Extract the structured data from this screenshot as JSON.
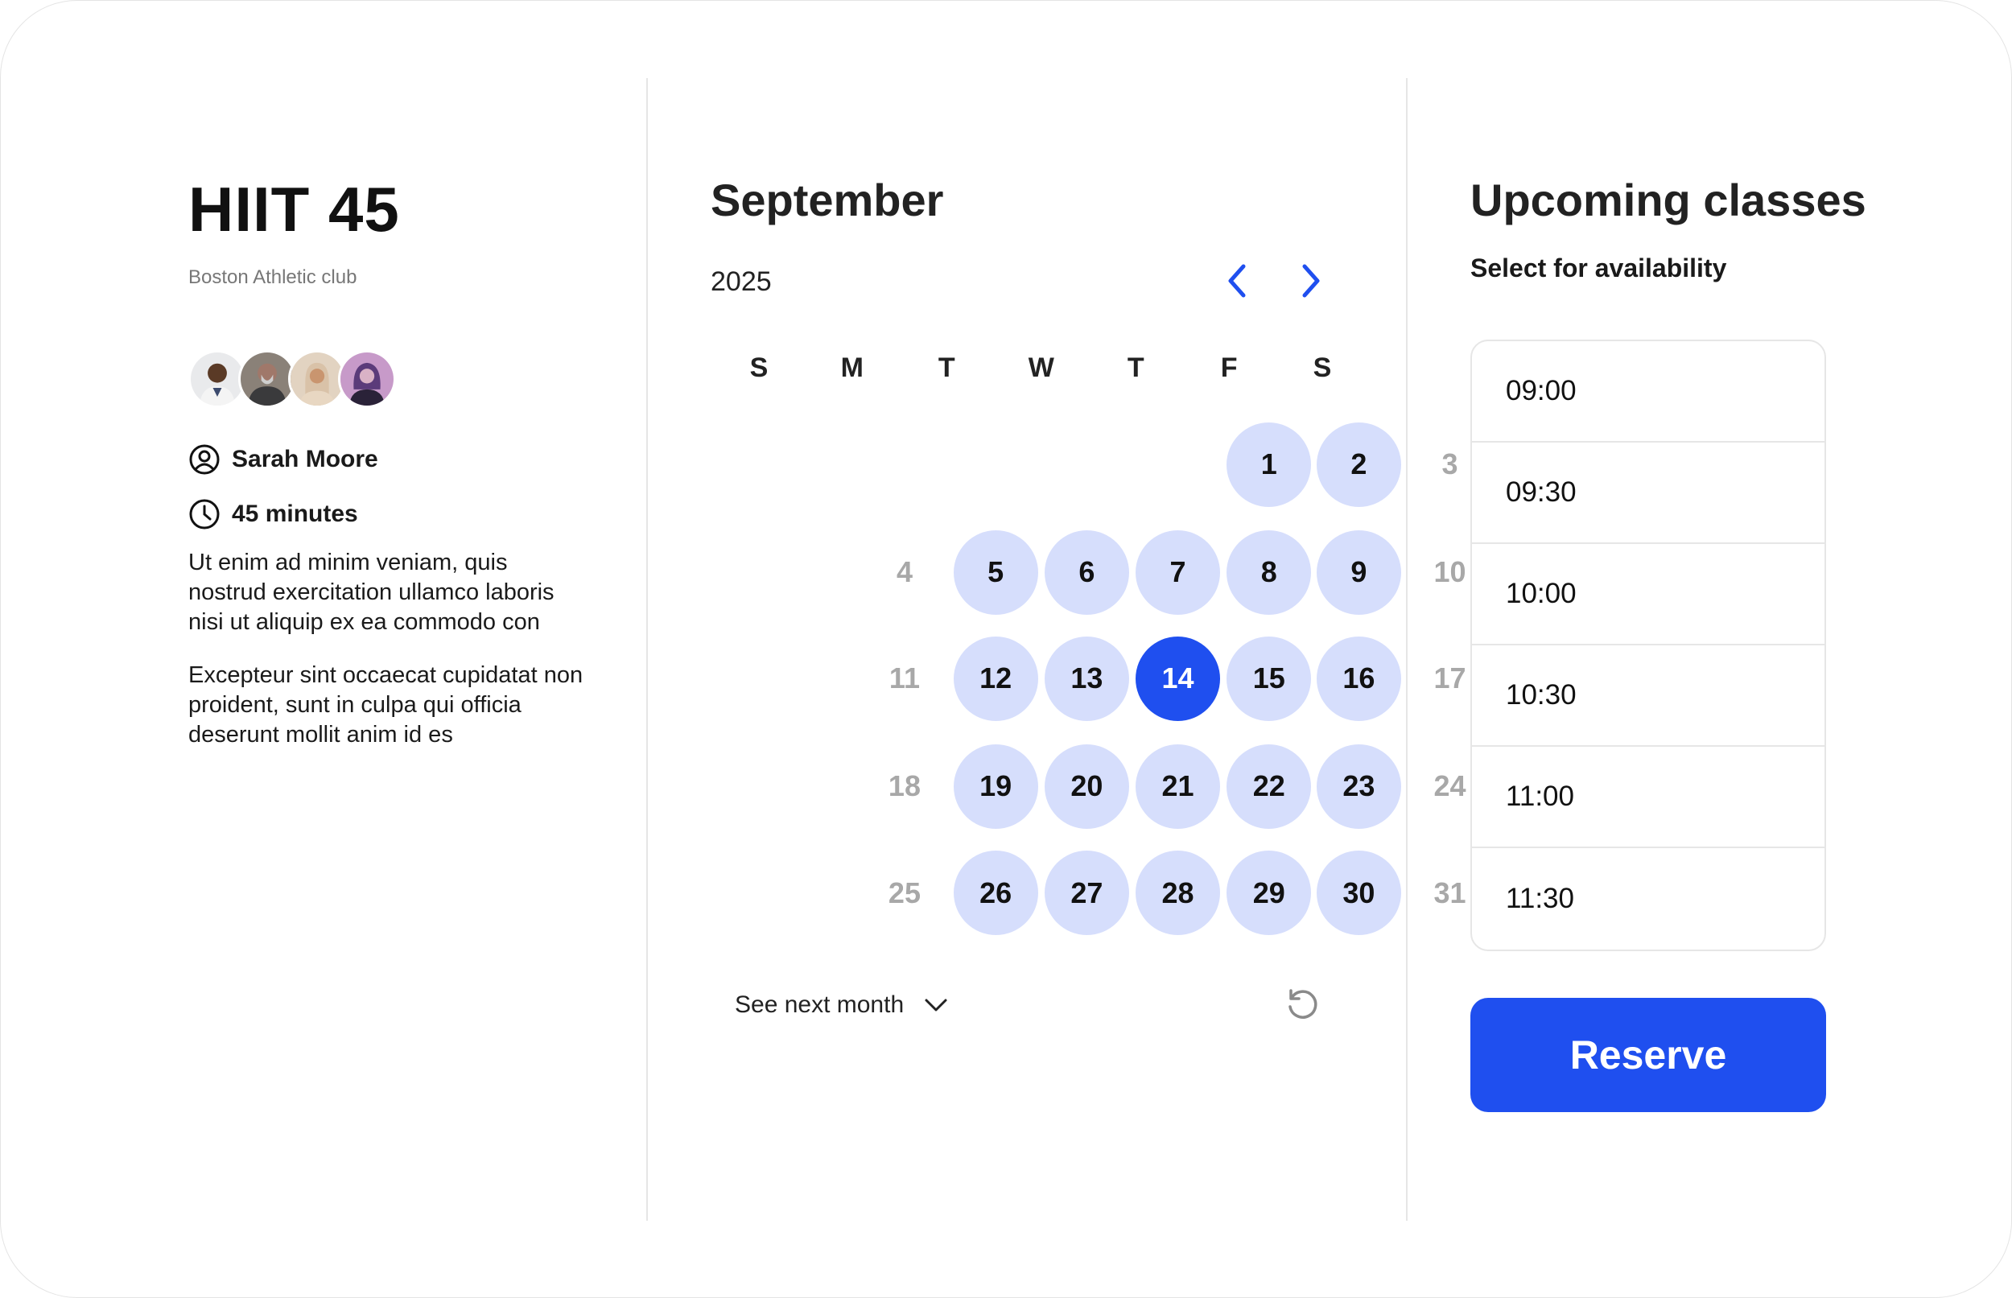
{
  "class_info": {
    "title": "HIIT 45",
    "club": "Boston Athletic club",
    "avatars": [
      "avatar-1",
      "avatar-2",
      "avatar-3",
      "avatar-4"
    ],
    "instructor": "Sarah Moore",
    "duration": "45 minutes",
    "description": [
      "Ut enim ad minim veniam, quis nostrud exercitation ullamco laboris nisi ut aliquip ex ea commodo con",
      "Excepteur sint occaecat cupidatat non proident, sunt in culpa qui officia deserunt mollit anim id es"
    ]
  },
  "calendar": {
    "month": "September",
    "year": "2025",
    "weekdays": [
      "S",
      "M",
      "T",
      "W",
      "T",
      "F",
      "S"
    ],
    "first_weekday_index": 4,
    "days_in_month": 30,
    "trailing_days": [
      "31"
    ],
    "available_days": [
      1,
      2,
      5,
      6,
      7,
      8,
      9,
      12,
      13,
      14,
      15,
      16,
      19,
      20,
      21,
      22,
      23,
      26,
      27,
      28,
      29,
      30
    ],
    "selected_day": 14,
    "see_next_month": "See next month",
    "colors": {
      "available": "#d6defc",
      "selected": "#1f4fef",
      "unavailable_text": "#a8a8a8"
    }
  },
  "upcoming": {
    "title": "Upcoming classes",
    "subtitle": "Select for availability",
    "slots": [
      "09:00",
      "09:30",
      "10:00",
      "10:30",
      "11:00",
      "11:30"
    ],
    "reserve_label": "Reserve",
    "accent": "#1f4fef"
  }
}
